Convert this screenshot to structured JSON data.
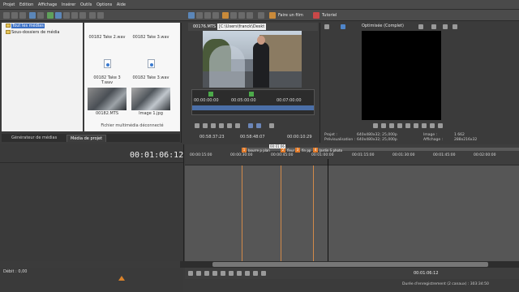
{
  "menu": [
    "Projet",
    "Edition",
    "Affichage",
    "Insérer",
    "Outils",
    "Options",
    "Aide"
  ],
  "toolbar": {
    "make_movie": "Faire un film",
    "tutorial": "Tutoriel"
  },
  "explorer": {
    "items": [
      "Tout les médias",
      "Sous-dossiers de média"
    ]
  },
  "media": {
    "items": [
      "00182 Take 2.wav",
      "00182 Take 3.wav",
      "00182 Take 3 T.wav",
      "00182 Take 3.wav",
      "00182.MTS",
      "Image 1.jpg"
    ],
    "status": "Fichier multimédia déconnecté"
  },
  "tabs": [
    "Générateur de médias",
    "Média de projet"
  ],
  "viewer": {
    "filename": "00176.MTS",
    "path": "[C:\\Users\\franck\\Deskt",
    "trim_times": [
      "00:00:00:00",
      "00:05:00:00",
      "00:07:00:00"
    ],
    "time_in": "00:58:37:23",
    "time_length": "00:58:48:07",
    "time_out": "00:00:10:29"
  },
  "preview": {
    "quality": "Optimisée (Complet)",
    "project_label": "Projet :",
    "project_value": "640x480x32; 25,000p",
    "previsu_label": "Prévisualisation :",
    "previsu_value": "640x480x32; 25,000p",
    "image_label": "Image :",
    "image_value": "1 662",
    "affichage_label": "Affichage :",
    "affichage_value": "288x216x32"
  },
  "timeline": {
    "current_time": "00:01:06:12",
    "ruler_labels": [
      "00:00:15:00",
      "00:00:30:00",
      "00:00:45:00",
      "00:01:00:00",
      "00:01:15:00",
      "00:01:30:00",
      "00:01:45:00",
      "00:02:00:00"
    ],
    "markers": [
      {
        "num": "1",
        "label": "bourre p plan"
      },
      {
        "num": "2",
        "label": "fleur"
      },
      {
        "num": "3",
        "label": "fin pp"
      },
      {
        "num": "4",
        "label": "Jardin S photo"
      }
    ],
    "marker_tag": "00:01:06"
  },
  "footer": {
    "rate": "Débit : 0,00",
    "time": "00:01:06:12",
    "status": "Durée d'enregistrement (2 canaux) : 303:34:50"
  }
}
